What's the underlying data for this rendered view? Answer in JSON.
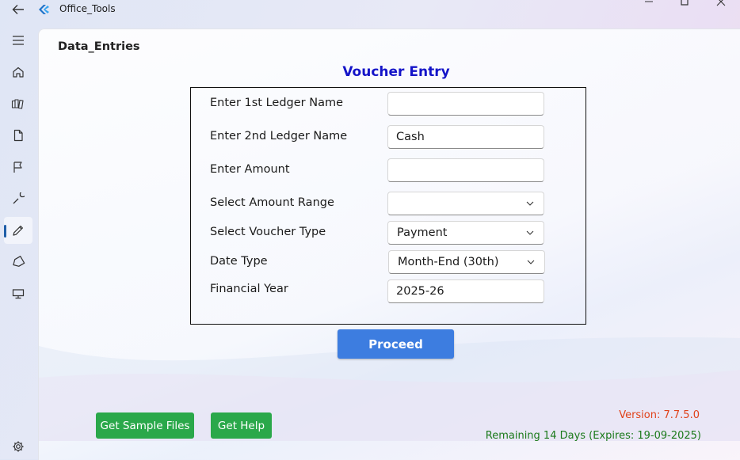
{
  "app": {
    "title": "Office_Tools"
  },
  "page": {
    "heading": "Data_Entries"
  },
  "form": {
    "title": "Voucher Entry",
    "fields": [
      {
        "label": "Enter 1st Ledger Name",
        "value": ""
      },
      {
        "label": "Enter 2nd Ledger Name",
        "value": "Cash"
      },
      {
        "label": "Enter Amount",
        "value": ""
      },
      {
        "label": "Select Amount Range",
        "value": ""
      },
      {
        "label": "Select Voucher Type",
        "value": "Payment"
      },
      {
        "label": "Date Type",
        "value": "Month-End (30th)"
      },
      {
        "label": "Financial Year",
        "value": "2025-26"
      }
    ],
    "proceed_label": "Proceed"
  },
  "footer": {
    "sample_files_label": "Get Sample Files",
    "help_label": "Get Help",
    "version": "Version: 7.7.5.0",
    "remaining": "Remaining 14 Days (Expires: 19-09-2025)"
  },
  "colors": {
    "accent": "#3d7de0",
    "green": "#2aa84a",
    "title_blue": "#1414c8",
    "version_orange": "#e0421a",
    "remaining_green": "#1b7a1b"
  },
  "nav": [
    "menu-icon",
    "home-icon",
    "book-icon",
    "document-icon",
    "flag-icon",
    "wrench-icon",
    "pencil-icon",
    "tag-icon",
    "monitor-icon",
    "gear-icon"
  ]
}
